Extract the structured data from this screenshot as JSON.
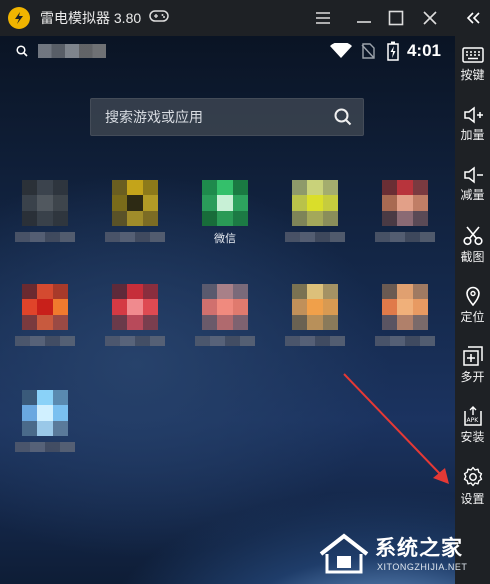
{
  "window": {
    "title": "雷电模拟器 3.80",
    "controls": [
      "menu-icon",
      "minimize-icon",
      "maximize-icon",
      "close-icon"
    ]
  },
  "status_bar": {
    "time": "4:01"
  },
  "search": {
    "placeholder": "搜索游戏或应用"
  },
  "apps": [
    {
      "label": "",
      "colors": [
        "#2b3138",
        "#3b434d",
        "#2e353e",
        "#3a424b",
        "#51585f",
        "#3e454c",
        "#2a3038",
        "#39414a",
        "#2f363e"
      ]
    },
    {
      "label": "",
      "colors": [
        "#6a5e20",
        "#c4a41a",
        "#8d7a1a",
        "#7a6b1a",
        "#2d2a14",
        "#b29b26",
        "#5a5228",
        "#a08c2a",
        "#7c6c24"
      ]
    },
    {
      "label": "微信",
      "colors": [
        "#1e8a4c",
        "#34c06b",
        "#1a7a42",
        "#2a9c5a",
        "#c8f0d6",
        "#2da35e",
        "#186c3a",
        "#2a9a56",
        "#1c7a44"
      ]
    },
    {
      "label": "",
      "colors": [
        "#8e9a6a",
        "#c9d27a",
        "#a4ad6e",
        "#b9c24a",
        "#dade2a",
        "#c6cc3e",
        "#7e8458",
        "#a4a85a",
        "#8a8e5a"
      ]
    },
    {
      "label": "",
      "colors": [
        "#6a2e34",
        "#b8343c",
        "#7a3a40",
        "#a86a52",
        "#e2a088",
        "#c07e66",
        "#4a3a44",
        "#8a6a74",
        "#5a4a56"
      ]
    },
    {
      "label": "",
      "colors": [
        "#6a2a30",
        "#d44a30",
        "#a83a2a",
        "#e0442a",
        "#c8201a",
        "#f07a2e",
        "#7a3a3e",
        "#c85a3e",
        "#9a4a44"
      ]
    },
    {
      "label": "",
      "colors": [
        "#5e2a3a",
        "#c62e3a",
        "#8a2e3e",
        "#d43a44",
        "#f08a8e",
        "#de4a52",
        "#6a3a4a",
        "#b84a5a",
        "#7a3e4e"
      ]
    },
    {
      "label": "",
      "colors": [
        "#5a5a6e",
        "#a88088",
        "#7a6a7a",
        "#d0706e",
        "#f08a7e",
        "#e07a6e",
        "#6a5a6a",
        "#b06a6e",
        "#7e6270"
      ]
    },
    {
      "label": "",
      "colors": [
        "#7a7252",
        "#dcc07a",
        "#a49264",
        "#c0905a",
        "#f0a04a",
        "#d89a52",
        "#6a6252",
        "#b8905a",
        "#8a7a5a"
      ]
    },
    {
      "label": "",
      "colors": [
        "#6a5a52",
        "#e0a070",
        "#a07a62",
        "#e07a4a",
        "#f0b07a",
        "#e89a62",
        "#5a5462",
        "#b0806a",
        "#7a6a6a"
      ]
    },
    {
      "label": "",
      "colors": [
        "#3a5a7a",
        "#8ad2f8",
        "#5a8ab0",
        "#6aa8e0",
        "#d0f0ff",
        "#7ac0f0",
        "#4a6a8a",
        "#9ac8e8",
        "#5a7a9a"
      ]
    }
  ],
  "sidebar": {
    "collapse_icon": "double-chevron-left-icon",
    "items": [
      {
        "label": "按键",
        "icon": "keyboard-icon"
      },
      {
        "label": "加量",
        "icon": "volume-up-icon"
      },
      {
        "label": "减量",
        "icon": "volume-down-icon"
      },
      {
        "label": "截图",
        "icon": "scissors-icon"
      },
      {
        "label": "定位",
        "icon": "location-pin-icon"
      },
      {
        "label": "多开",
        "icon": "multi-instance-icon"
      },
      {
        "label": "安装",
        "icon": "apk-install-icon"
      },
      {
        "label": "设置",
        "icon": "gear-icon"
      }
    ]
  },
  "watermark": {
    "title": "系统之家",
    "subtitle": "XITONGZHIJIA.NET"
  },
  "colors": {
    "chrome": "#1e2125",
    "arrow": "#e53935",
    "logo": "#f0b400"
  }
}
